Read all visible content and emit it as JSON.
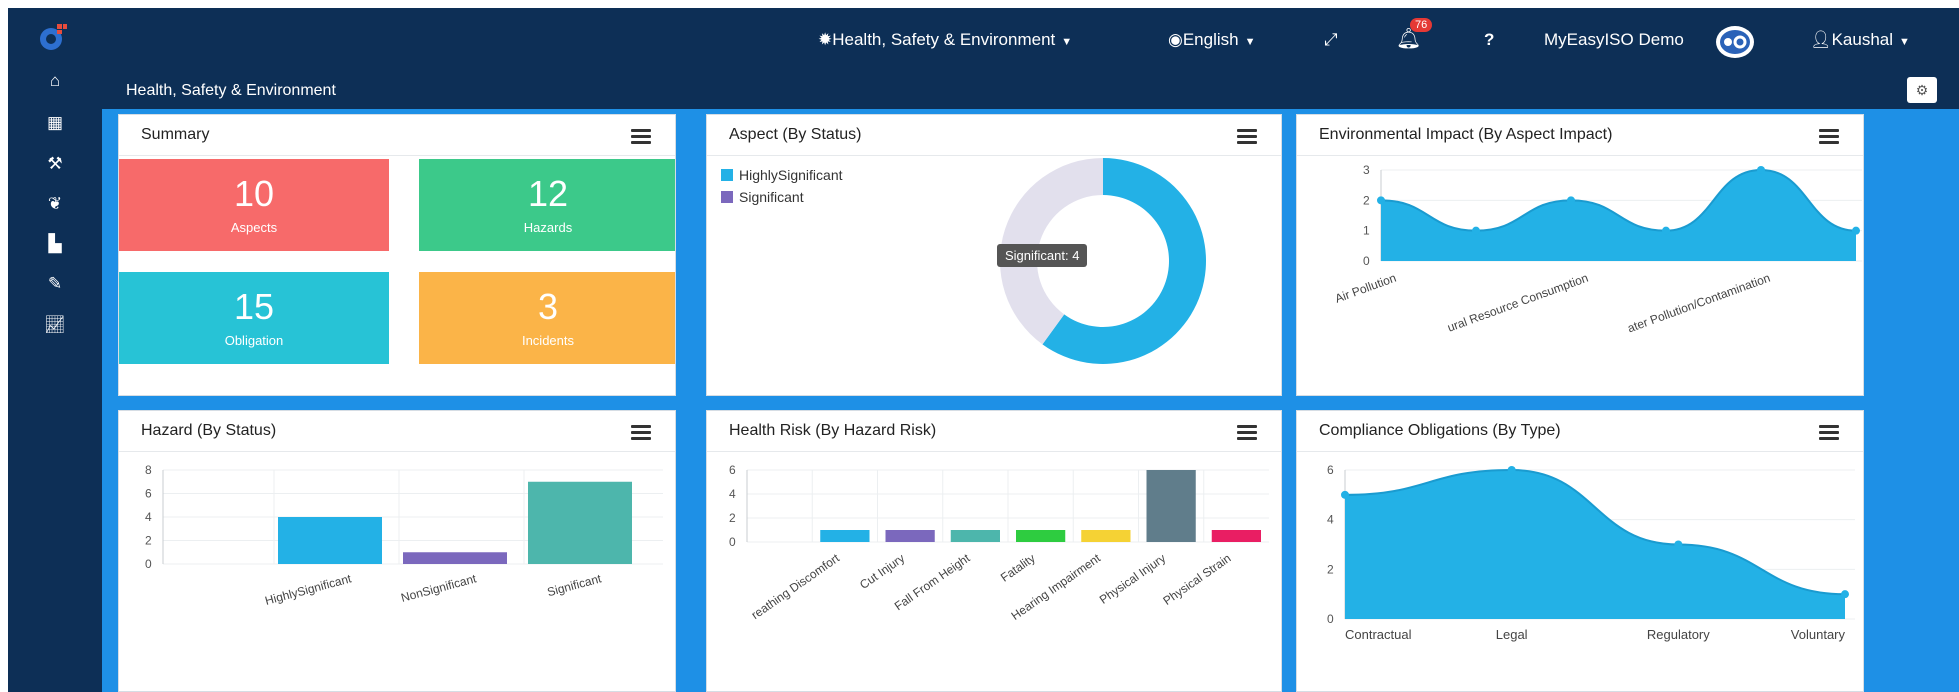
{
  "topbar": {
    "module_label": "Health, Safety & Environment",
    "language_label": "English",
    "notification_count": "76",
    "help_label": "?",
    "org_label": "MyEasyISO Demo",
    "user_label": "Kaushal"
  },
  "page": {
    "title": "Health, Safety & Environment"
  },
  "summary": {
    "title": "Summary",
    "tiles": [
      {
        "value": "10",
        "label": "Aspects",
        "color": "#f76a6a"
      },
      {
        "value": "12",
        "label": "Hazards",
        "color": "#3cc98a"
      },
      {
        "value": "15",
        "label": "Obligation",
        "color": "#27c3d6"
      },
      {
        "value": "3",
        "label": "Incidents",
        "color": "#fbb448"
      }
    ]
  },
  "aspect": {
    "title": "Aspect (By Status)",
    "tooltip": "Significant: 4"
  },
  "env_impact": {
    "title": "Environmental Impact (By Aspect Impact)"
  },
  "hazard": {
    "title": "Hazard (By Status)"
  },
  "health_risk": {
    "title": "Health Risk (By Hazard Risk)"
  },
  "compliance": {
    "title": "Compliance Obligations (By Type)"
  },
  "chart_data": [
    {
      "type": "pie",
      "legend": [
        "HighlySignificant",
        "Significant"
      ],
      "series": [
        {
          "name": "HighlySignificant",
          "values": [
            6
          ]
        },
        {
          "name": "Significant",
          "values": [
            4
          ]
        }
      ],
      "colors": [
        "#23b1e6",
        "#e2e0ed"
      ],
      "legend_placement": "top-left"
    },
    {
      "type": "area",
      "x": [
        "Air Pollution",
        "",
        "Natural Resource Consumption",
        "",
        "Water Pollution/Contamination",
        ""
      ],
      "x_tick_labels": [
        "Air Pollution",
        "...ural Resource Consumption",
        "...ater Pollution/Contamination"
      ],
      "values": [
        2,
        1,
        2,
        1,
        3,
        1
      ],
      "ylim": [
        0,
        3
      ],
      "yticks": [
        0,
        1,
        2,
        3
      ],
      "color": "#23b1e6"
    },
    {
      "type": "bar",
      "categories": [
        "HighlySignificant",
        "NonSignificant",
        "Significant"
      ],
      "values": [
        4,
        1,
        7
      ],
      "colors": [
        "#23b1e6",
        "#7b68bd",
        "#4db6ac"
      ],
      "ylim": [
        0,
        8
      ],
      "yticks": [
        0,
        2,
        4,
        6,
        8
      ]
    },
    {
      "type": "bar",
      "categories": [
        "Breathing Discomfort",
        "Cut Injury",
        "Fall From Height",
        "Fatality",
        "Hearing Impairment",
        "Physical Injury",
        "Physical Strain"
      ],
      "x_tick_labels": [
        "...reathing Discomfort",
        "Cut Injury",
        "Fall From Height",
        "Fatality",
        "Hearing Impairment",
        "Physical Injury",
        "Physical Strain"
      ],
      "values": [
        0,
        1,
        1,
        1,
        1,
        1,
        6,
        1
      ],
      "bar_values": [
        1,
        1,
        1,
        1,
        1,
        6,
        1
      ],
      "colors": [
        "#23b1e6",
        "#7b68bd",
        "#4db6ac",
        "#2ecc40",
        "#f5d234",
        "#607d8b",
        "#e91e63"
      ],
      "ylim": [
        0,
        6
      ],
      "yticks": [
        0,
        2,
        4,
        6
      ]
    },
    {
      "type": "area",
      "categories": [
        "Contractual",
        "Legal",
        "Regulatory",
        "Voluntary"
      ],
      "values": [
        5,
        6,
        3,
        1
      ],
      "ylim": [
        0,
        6
      ],
      "yticks": [
        0,
        2,
        4,
        6
      ],
      "color": "#23b1e6"
    }
  ]
}
